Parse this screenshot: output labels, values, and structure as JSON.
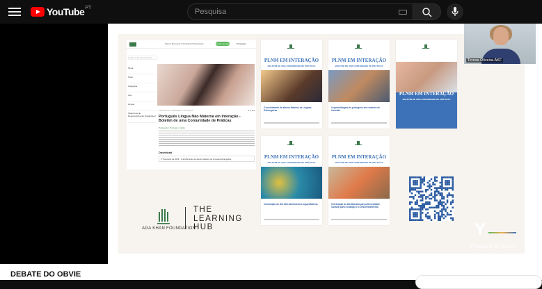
{
  "header": {
    "logo_text": "YouTube",
    "region": "PT",
    "search_placeholder": "Pesquisa",
    "icons": {
      "menu": "hamburger-icon",
      "search": "search-icon",
      "mic": "microphone-icon",
      "keyboard": "keyboard-icon"
    }
  },
  "slide": {
    "website": {
      "nav_links": "Sites ▾   Recursos ▾   Iniciativa ▾   Parcerias ▾",
      "nav_button": "Iniciar sessão",
      "nav_lang": "Português",
      "search_placeholder": "O Que é que está a procura?",
      "sidebar": [
        "Tema",
        "Nível",
        "Categoria",
        "Ano",
        "Língua",
        "Objectivos de Desenvolvimento Sustentável"
      ],
      "share_label": "Ferramenta • Publicação • Português",
      "title": "Português Língua Não Materna em Interação - Boletim de uma Comunidade de Práticas",
      "meta": "Português | Portugal  •  Inglês",
      "download_title": "Download",
      "download_row": "1º Semestre de 2023 - O acolhimento de alunos falantes de Línguas Estrangeiras"
    },
    "bulletins": [
      {
        "title": "PLNM EM INTERAÇÃO",
        "subtitle": "BOLETIM DE UMA COMUNIDADE DE PRÁTICAS",
        "caption": "O acolhimento de alunos falantes de Línguas Estrangeiras",
        "image_colors": [
          "#f3c98a",
          "#5a3a2a"
        ]
      },
      {
        "title": "PLNM EM INTERAÇÃO",
        "subtitle": "BOLETIM DE UMA COMUNIDADE DE PRÁTICAS",
        "caption": "A aprendizagem do português em contexto de inclusão",
        "image_colors": [
          "#7a9ac0",
          "#c08a60"
        ]
      },
      {
        "title": "PLNM EM INTERAÇÃO",
        "subtitle": "BOLETIM DE UMA COMUNIDADE DE PRÁTICAS",
        "caption": "",
        "image_colors": [
          "#e8b8a0",
          "#2f68b8"
        ]
      },
      {
        "title": "PLNM EM INTERAÇÃO",
        "subtitle": "BOLETIM DE UMA COMUNIDADE DE PRÁTICAS",
        "caption": "Celebração do Dia Internacional da Língua Materna",
        "image_colors": [
          "#2a8aa8",
          "#e0c040"
        ]
      },
      {
        "title": "PLNM EM INTERAÇÃO",
        "subtitle": "BOLETIM DE UMA COMUNIDADE DE PRÁTICAS",
        "caption": "Celebração do Dia Mundial para a Diversidade Cultural para o Diálogo e o Desenvolvimento",
        "image_colors": [
          "#c8b89a",
          "#e07a4a"
        ]
      }
    ],
    "foundation_name": "AGA KHAN FOUNDATION",
    "hub_line1": "THE",
    "hub_line2": "LEARNING",
    "hub_line3": "HUB",
    "zoom_watermark": "Powered by Zoom",
    "colors": {
      "bulletin_blue": "#3d72b8",
      "foundation_green": "#3a7a4a",
      "slide_bg": "#f7f3ef"
    }
  },
  "webcam": {
    "participant_name": "Teresa Oliveira-AKF"
  },
  "video": {
    "title": "DEBATE DO OBVIE"
  }
}
